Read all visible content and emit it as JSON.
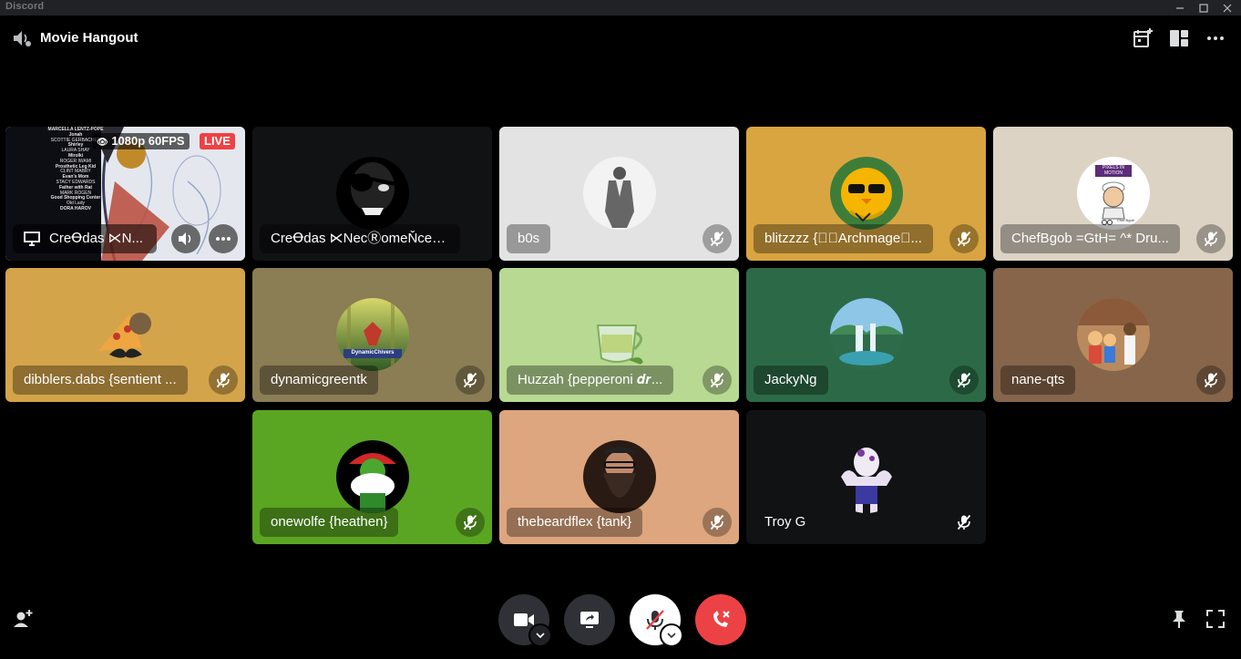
{
  "titlebar": {
    "app_name": "Discord"
  },
  "header": {
    "title": "Movie Hangout"
  },
  "stream": {
    "quality": "1080p 60FPS",
    "live": "LIVE",
    "name": "CreꝊdas ⋉N...",
    "credits": [
      "MARCELLA LENTZ-POPE",
      "Jonah",
      "SCOTTIE GERBACHER",
      "Shirley",
      "LAURA SHAY",
      "Mirolki",
      "ROGER IWAMI",
      "Prosthetic Leg Kid",
      "CLINT MABRY",
      "Evan's Mom",
      "STACY EDWARDS",
      "Father with Rat",
      "MARK ROGEN",
      "Good Shopping Center",
      "Old Lady",
      "DORA HAROV"
    ]
  },
  "participants": [
    {
      "name": "CreꝊdas ⋉NecⓇomeŇceⓇ⋊",
      "bg": "#111214",
      "muted": false
    },
    {
      "name": "b0s",
      "bg": "#e3e3e3",
      "muted": true
    },
    {
      "name": "blitzzzz {☌ᷦArchmage⃝...",
      "bg": "#d9a540",
      "muted": true
    },
    {
      "name": "ChefBgob =GtH= ^* Dru...",
      "bg": "#ddd3c4",
      "muted": true
    },
    {
      "name": "dibblers.dabs {sentient ...",
      "bg": "#d4a44a",
      "muted": true
    },
    {
      "name": "dynamicgreentk",
      "bg": "#8b7d54",
      "muted": true
    },
    {
      "name": "Huzzah {pepperoni 𝒅𝒓...",
      "bg": "#b8d992",
      "muted": true
    },
    {
      "name": "JackyNg",
      "bg": "#2c6a47",
      "muted": true
    },
    {
      "name": "nane-qts",
      "bg": "#86654a",
      "muted": true
    },
    {
      "name": "onewolfe {heathen}",
      "bg": "#5aa622",
      "muted": true
    },
    {
      "name": "thebeardflex {tank}",
      "bg": "#dea67e",
      "muted": true
    },
    {
      "name": "Troy G",
      "bg": "#111214",
      "muted": true
    }
  ],
  "chefbgob_badge": {
    "line1": "PIXELS IN",
    "line2": "MOTION",
    "signature": "Chef Bgob"
  },
  "dynamic_banner": "DynamicChivers",
  "colors": {
    "live": "#ed4245",
    "hangup": "#ed4245",
    "accent": "#5865f2"
  },
  "controls": [
    "video-camera-icon",
    "screen-share-icon",
    "microphone-muted-icon",
    "hang-up-icon"
  ]
}
